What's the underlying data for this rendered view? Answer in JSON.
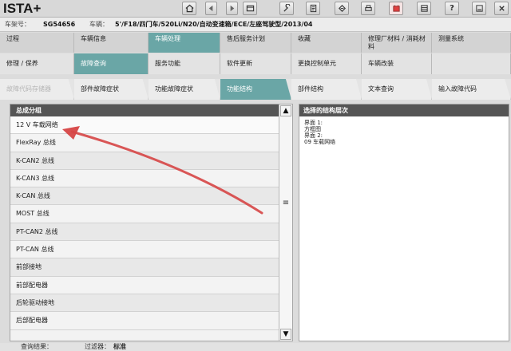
{
  "app": {
    "title": "ISTA+"
  },
  "toolbar": {
    "buttons": [
      {
        "icon": "home-icon",
        "glyph": "⌂"
      },
      {
        "icon": "back-icon",
        "glyph": "◀"
      },
      {
        "icon": "forward-icon",
        "glyph": "▶"
      },
      {
        "icon": "window-icon",
        "glyph": "▭"
      },
      {
        "icon": "wrench-icon",
        "glyph": "✎"
      },
      {
        "icon": "document-icon",
        "glyph": "☰"
      },
      {
        "icon": "tag-icon",
        "glyph": "◇"
      },
      {
        "icon": "print-icon",
        "glyph": "▦"
      },
      {
        "icon": "battery-icon",
        "glyph": "▣"
      },
      {
        "icon": "workshop-icon",
        "glyph": "▤"
      },
      {
        "icon": "help-icon",
        "glyph": "?"
      },
      {
        "icon": "minimize-icon",
        "glyph": "▬"
      },
      {
        "icon": "close-icon",
        "glyph": "✕"
      }
    ]
  },
  "vehicle": {
    "vin_label": "车架号：",
    "vin": "SG54656",
    "vehicle_label": "车辆：",
    "vehicle_value": "5'/F18/四门车/520Li/N20/自动变速箱/ECE/左座驾驶型/2013/04"
  },
  "nav": {
    "row1": [
      "过程",
      "车辆信息",
      "车辆处理",
      "售后服务计划",
      "收藏",
      "修理厂材料 / 消耗材料",
      "测量系统"
    ],
    "row2": [
      "修理 / 保养",
      "故障查询",
      "服务功能",
      "软件更新",
      "更换控制单元",
      "车辆改装",
      ""
    ],
    "row3": [
      "故障代码存储器",
      "部件故障症状",
      "功能故障症状",
      "功能结构",
      "部件结构",
      "文本查询",
      "输入故障代码"
    ]
  },
  "left_panel": {
    "header": "总成分组",
    "items": [
      "12 V 车载网络",
      "FlexRay 总线",
      "K-CAN2 总线",
      "K-CAN3 总线",
      "K-CAN 总线",
      "MOST 总线",
      "PT-CAN2 总线",
      "PT-CAN 总线",
      "前部接地",
      "前部配电器",
      "后轮驱动接地",
      "后部配电器"
    ]
  },
  "right_panel": {
    "header": "选择的结构层次",
    "lines": [
      "界面 1:",
      "方框图",
      "界面 2:",
      "09 车载网络"
    ]
  },
  "status": {
    "result_label": "查询结果：",
    "filter_label": "过滤器：",
    "filter_value": "标准"
  },
  "colors": {
    "accent_tab": "#6aa6a6",
    "annotation_arrow": "#d64545",
    "panel_header": "#555555"
  }
}
